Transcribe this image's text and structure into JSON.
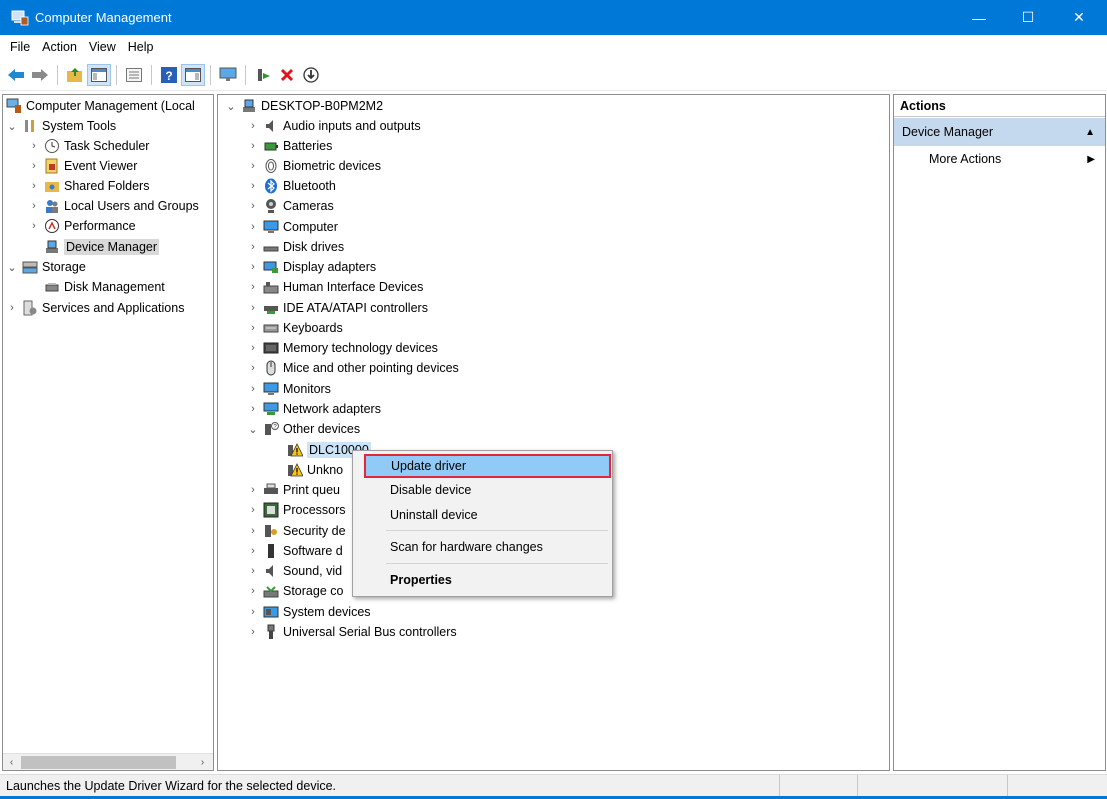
{
  "window": {
    "title": "Computer Management",
    "minimize": "—",
    "maximize": "☐",
    "close": "✕"
  },
  "menu": [
    "File",
    "Action",
    "View",
    "Help"
  ],
  "left_tree": {
    "root": "Computer Management (Local",
    "system_tools": "System Tools",
    "task_scheduler": "Task Scheduler",
    "event_viewer": "Event Viewer",
    "shared_folders": "Shared Folders",
    "local_users": "Local Users and Groups",
    "performance": "Performance",
    "device_manager": "Device Manager",
    "storage": "Storage",
    "disk_management": "Disk Management",
    "services": "Services and Applications"
  },
  "device_tree": {
    "root": "DESKTOP-B0PM2M2",
    "categories": [
      "Audio inputs and outputs",
      "Batteries",
      "Biometric devices",
      "Bluetooth",
      "Cameras",
      "Computer",
      "Disk drives",
      "Display adapters",
      "Human Interface Devices",
      "IDE ATA/ATAPI controllers",
      "Keyboards",
      "Memory technology devices",
      "Mice and other pointing devices",
      "Monitors",
      "Network adapters",
      "Other devices"
    ],
    "other_devices": [
      "DLC10000",
      "Unkno"
    ],
    "after": [
      "Print queu",
      "Processors",
      "Security de",
      "Software d",
      "Sound, vid",
      "Storage co",
      "System devices",
      "Universal Serial Bus controllers"
    ]
  },
  "context_menu": {
    "update": "Update driver",
    "disable": "Disable device",
    "uninstall": "Uninstall device",
    "scan": "Scan for hardware changes",
    "properties": "Properties"
  },
  "actions": {
    "header": "Actions",
    "group": "Device Manager",
    "more": "More Actions"
  },
  "status": {
    "text": "Launches the Update Driver Wizard for the selected device."
  }
}
